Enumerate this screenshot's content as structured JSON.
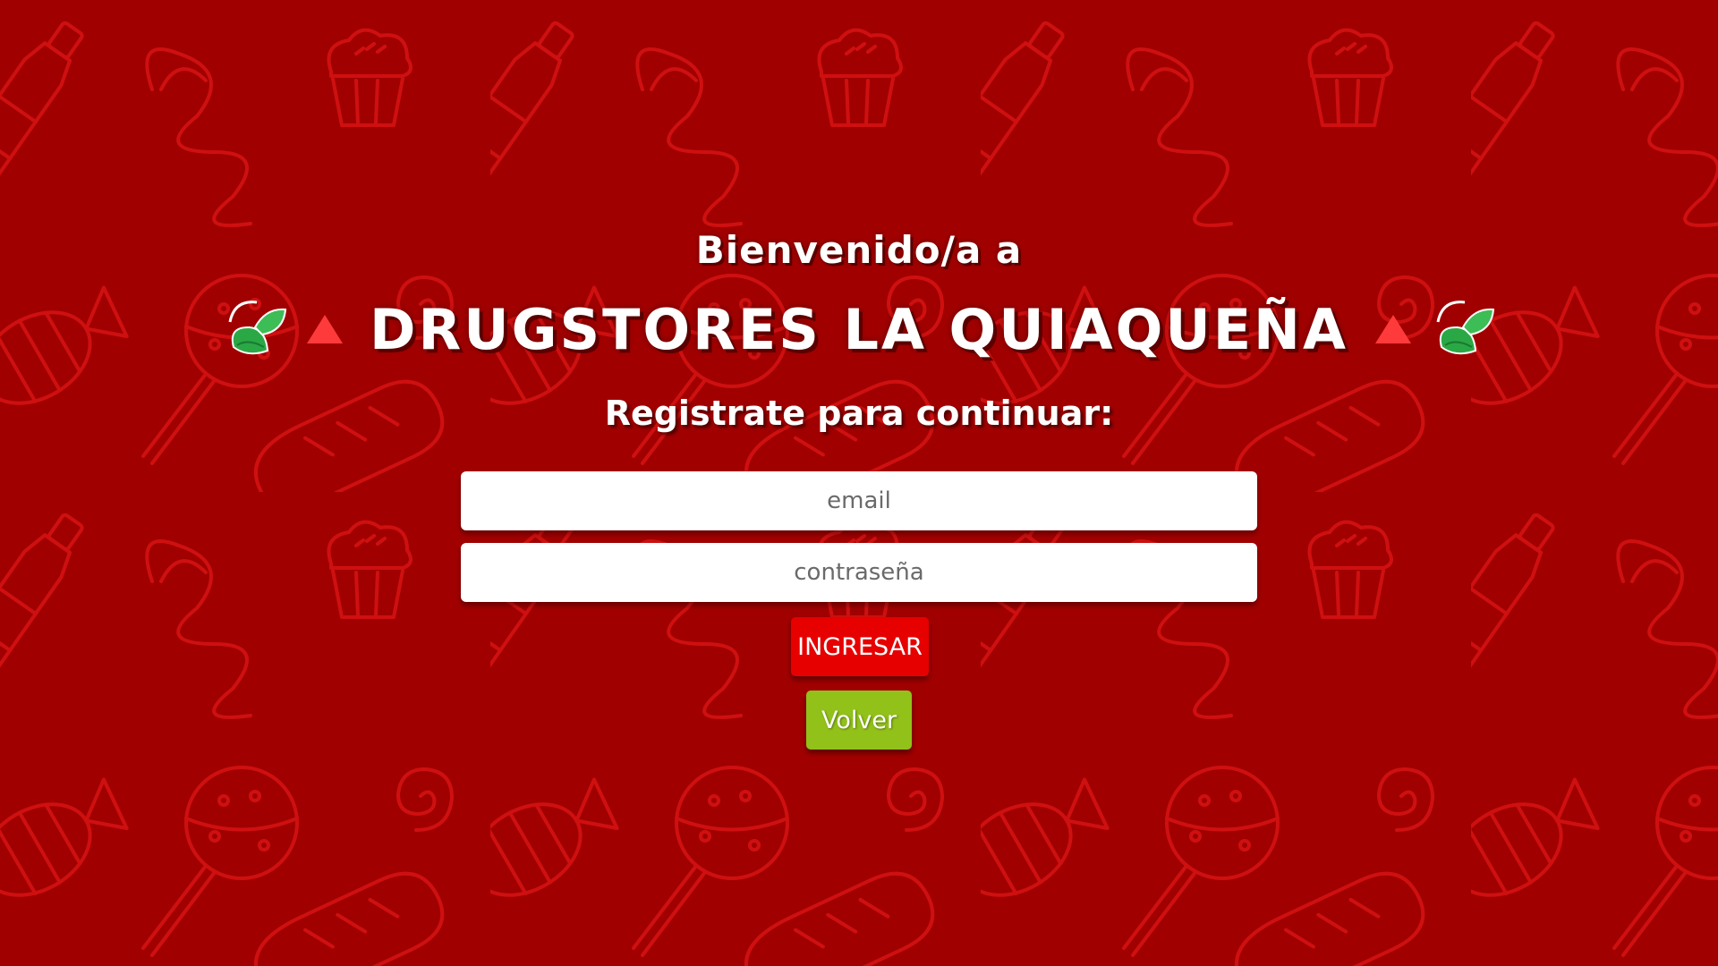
{
  "header": {
    "welcome": "Bienvenido/a a",
    "title": "DRUGSTORES LA QUIAQUEÑA",
    "subtitle": "Registrate para continuar:"
  },
  "form": {
    "email_placeholder": "email",
    "password_placeholder": "contraseña",
    "submit_label": "INGRESAR",
    "back_label": "Volver"
  },
  "icons": {
    "left_decoration": [
      "leaf-icon",
      "triangle-icon"
    ],
    "right_decoration": [
      "triangle-icon",
      "leaf-icon"
    ],
    "background_pattern": [
      "bottle-icon",
      "cupcake-icon",
      "squiggle-icon",
      "candy-icon",
      "lollipop-icon",
      "bread-icon",
      "spiral-icon"
    ]
  },
  "colors": {
    "background": "#a10000",
    "pattern": "#d41111",
    "submit_button": "#e60000",
    "back_button": "#92c11a",
    "text": "#ffffff"
  }
}
